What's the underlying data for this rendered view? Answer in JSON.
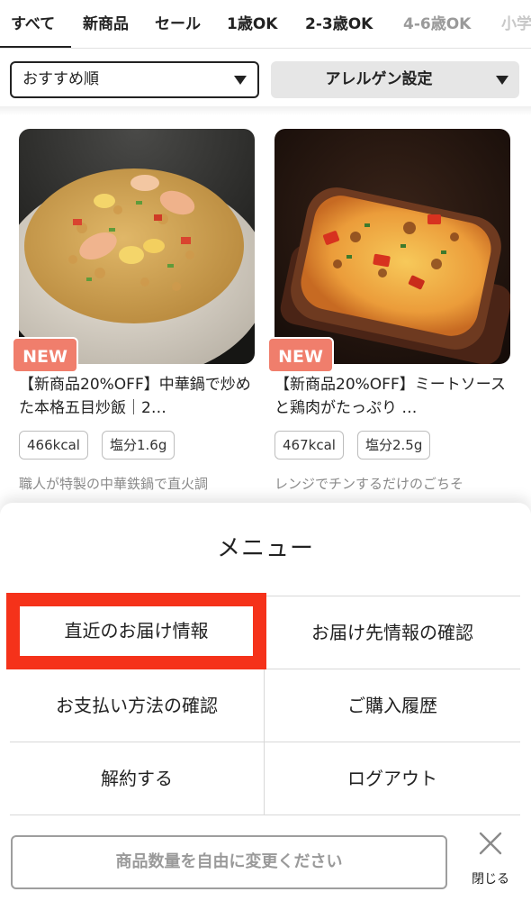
{
  "tabs": [
    {
      "label": "すべて",
      "active": true
    },
    {
      "label": "新商品"
    },
    {
      "label": "セール"
    },
    {
      "label": "1歳OK"
    },
    {
      "label": "2-3歳OK"
    },
    {
      "label": "4-6歳OK"
    },
    {
      "label": "小学"
    }
  ],
  "filters": {
    "sort_value": "おすすめ順",
    "allergen_label": "アレルゲン設定"
  },
  "products": [
    {
      "badge": "NEW",
      "title": "【新商品20%OFF】中華鍋で炒めた本格五目炒飯｜2…",
      "calories": "466kcal",
      "salt": "塩分1.6g",
      "description": "職人が特製の中華鉄鍋で直火調"
    },
    {
      "badge": "NEW",
      "title": "【新商品20%OFF】ミートソースと鶏肉がたっぷり …",
      "calories": "467kcal",
      "salt": "塩分2.5g",
      "description": "レンジでチンするだけのごちそ"
    }
  ],
  "menu": {
    "title": "メニュー",
    "items": [
      "直近のお届け情報",
      "お届け先情報の確認",
      "お支払い方法の確認",
      "ご購入履歴",
      "解約する",
      "ログアウト"
    ],
    "highlighted_index": 0
  },
  "footer": {
    "quantity_placeholder": "商品数量を自由に変更ください",
    "close_label": "閉じる"
  },
  "colors": {
    "new_badge": "#f07e6c",
    "highlight_border": "#f5321a"
  }
}
